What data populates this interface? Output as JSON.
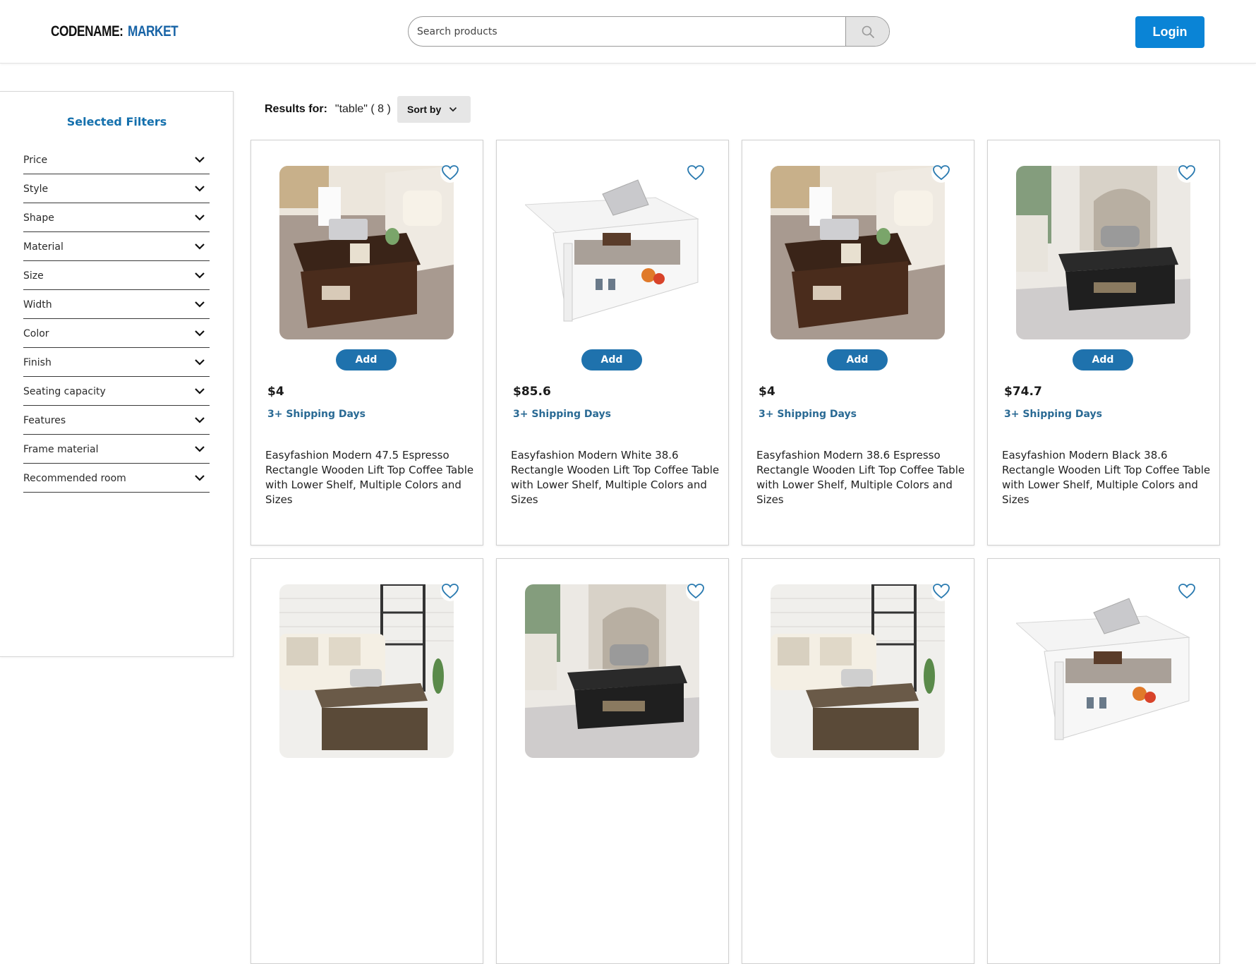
{
  "header": {
    "logo_part1": "CODENAME:",
    "logo_part2": "MARKET",
    "search_placeholder": "Search products",
    "search_icon": "search-icon",
    "login_label": "Login"
  },
  "sidebar": {
    "title": "Selected Filters",
    "filters": [
      {
        "label": "Price"
      },
      {
        "label": "Style"
      },
      {
        "label": "Shape"
      },
      {
        "label": "Material"
      },
      {
        "label": "Size"
      },
      {
        "label": "Width"
      },
      {
        "label": "Color"
      },
      {
        "label": "Finish"
      },
      {
        "label": "Seating capacity"
      },
      {
        "label": "Features"
      },
      {
        "label": "Frame material"
      },
      {
        "label": "Recommended room"
      }
    ]
  },
  "results": {
    "label": "Results for:",
    "query": "\"table\" ( 8 )",
    "sort_label": "Sort by"
  },
  "products": [
    {
      "price": "$4",
      "shipping": "3+ Shipping Days",
      "add_label": "Add",
      "name": "Easyfashion Modern 47.5 Espresso Rectangle Wooden Lift Top Coffee Table with Lower Shelf, Multiple Colors and Sizes",
      "image": "espresso-coffee-table-photo"
    },
    {
      "price": "$85.6",
      "shipping": "3+ Shipping Days",
      "add_label": "Add",
      "name": "Easyfashion Modern White 38.6 Rectangle Wooden Lift Top Coffee Table with Lower Shelf, Multiple Colors and Sizes",
      "image": "white-coffee-table-photo"
    },
    {
      "price": "$4",
      "shipping": "3+ Shipping Days",
      "add_label": "Add",
      "name": "Easyfashion Modern 38.6 Espresso Rectangle Wooden Lift Top Coffee Table with Lower Shelf, Multiple Colors and Sizes",
      "image": "espresso-coffee-table-photo"
    },
    {
      "price": "$74.7",
      "shipping": "3+ Shipping Days",
      "add_label": "Add",
      "name": "Easyfashion Modern Black 38.6 Rectangle Wooden Lift Top Coffee Table with Lower Shelf, Multiple Colors and Sizes",
      "image": "black-coffee-table-photo"
    },
    {
      "price": "",
      "shipping": "",
      "add_label": "",
      "name": "",
      "image": "rustic-coffee-table-photo"
    },
    {
      "price": "",
      "shipping": "",
      "add_label": "",
      "name": "",
      "image": "black-coffee-table-photo"
    },
    {
      "price": "",
      "shipping": "",
      "add_label": "",
      "name": "",
      "image": "rustic-coffee-table-photo"
    },
    {
      "price": "",
      "shipping": "",
      "add_label": "",
      "name": "",
      "image": "white-coffee-table-photo"
    }
  ],
  "colors": {
    "brand_blue": "#1763a6",
    "login_blue": "#0a84d6",
    "add_button": "#1f72ad",
    "heart": "#2a7ab0",
    "shipping_text": "#2a6a94",
    "filter_title": "#1470ad"
  }
}
